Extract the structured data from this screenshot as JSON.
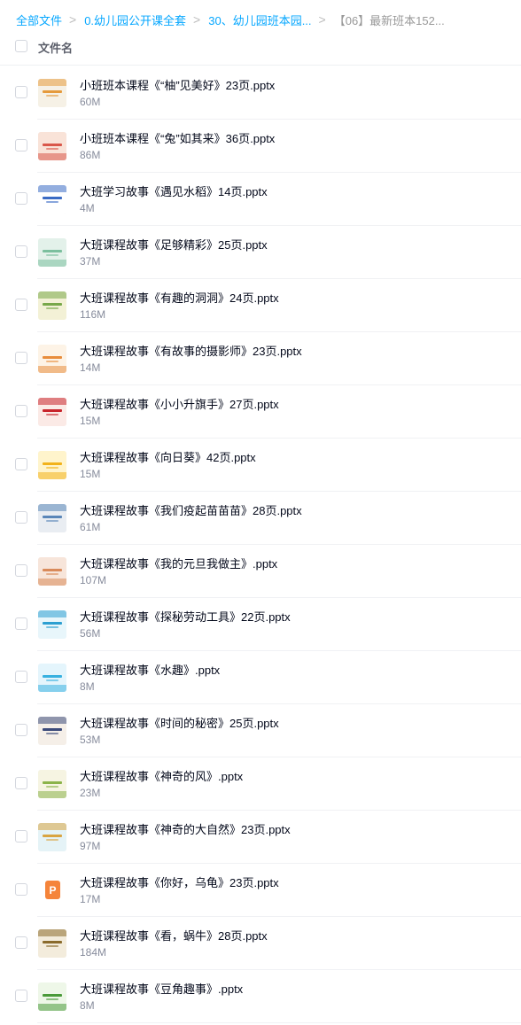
{
  "breadcrumb": {
    "items": [
      "全部文件",
      "0.幼儿园公开课全套",
      "30、幼儿园班本园...",
      "【06】最新班本152..."
    ],
    "separator": ">"
  },
  "table": {
    "column_name": "文件名"
  },
  "files": [
    {
      "name": "小班班本课程《“柚”见美好》23页.pptx",
      "size": "60M",
      "thumb_icon": "slide-thumbnail",
      "bg": "#f6f1e6",
      "accent": "#e59a3c"
    },
    {
      "name": "小班班本课程《“兔”如其来》36页.pptx",
      "size": "86M",
      "thumb_icon": "slide-thumbnail",
      "bg": "#f9e3d8",
      "accent": "#d9574a"
    },
    {
      "name": "大班学习故事《遇见水稻》14页.pptx",
      "size": "4M",
      "thumb_icon": "slide-thumbnail",
      "bg": "#ffffff",
      "accent": "#3a6bc4"
    },
    {
      "name": "大班课程故事《足够精彩》25页.pptx",
      "size": "37M",
      "thumb_icon": "slide-thumbnail",
      "bg": "#e3f1ea",
      "accent": "#7bbf9e"
    },
    {
      "name": "大班课程故事《有趣的洞洞》24页.pptx",
      "size": "116M",
      "thumb_icon": "slide-thumbnail",
      "bg": "#f3f1d6",
      "accent": "#78a84a"
    },
    {
      "name": "大班课程故事《有故事的摄影师》23页.pptx",
      "size": "14M",
      "thumb_icon": "slide-thumbnail",
      "bg": "#fdf3e6",
      "accent": "#e88d3c"
    },
    {
      "name": "大班课程故事《小小升旗手》27页.pptx",
      "size": "15M",
      "thumb_icon": "slide-thumbnail",
      "bg": "#fbeae6",
      "accent": "#c8252c"
    },
    {
      "name": "大班课程故事《向日葵》42页.pptx",
      "size": "15M",
      "thumb_icon": "slide-thumbnail",
      "bg": "#fff4cc",
      "accent": "#f2b21b"
    },
    {
      "name": "大班课程故事《我们疫起苗苗苗》28页.pptx",
      "size": "61M",
      "thumb_icon": "slide-thumbnail",
      "bg": "#e9edf2",
      "accent": "#5a86b8"
    },
    {
      "name": "大班课程故事《我的元旦我做主》.pptx",
      "size": "107M",
      "thumb_icon": "slide-thumbnail",
      "bg": "#f7e5da",
      "accent": "#d98a5a"
    },
    {
      "name": "大班课程故事《探秘劳动工具》22页.pptx",
      "size": "56M",
      "thumb_icon": "slide-thumbnail",
      "bg": "#e8f6fb",
      "accent": "#2c9fd1"
    },
    {
      "name": "大班课程故事《水趣》.pptx",
      "size": "8M",
      "thumb_icon": "slide-thumbnail",
      "bg": "#e4f5fc",
      "accent": "#38b1e0"
    },
    {
      "name": "大班课程故事《时间的秘密》25页.pptx",
      "size": "53M",
      "thumb_icon": "slide-thumbnail",
      "bg": "#f5efe8",
      "accent": "#3b4a7a"
    },
    {
      "name": "大班课程故事《神奇的风》.pptx",
      "size": "23M",
      "thumb_icon": "slide-thumbnail",
      "bg": "#f6f4e2",
      "accent": "#8bb34a"
    },
    {
      "name": "大班课程故事《神奇的大自然》23页.pptx",
      "size": "97M",
      "thumb_icon": "slide-thumbnail",
      "bg": "#e5f3f7",
      "accent": "#d9a441"
    },
    {
      "name": "大班课程故事《你好，乌龟》23页.pptx",
      "size": "17M",
      "thumb_icon": "pptx-file-icon",
      "bg": "#ffffff",
      "accent": "#f5843a"
    },
    {
      "name": "大班课程故事《看，蜗牛》28页.pptx",
      "size": "184M",
      "thumb_icon": "slide-thumbnail",
      "bg": "#f3ecdc",
      "accent": "#8a6b2c"
    },
    {
      "name": "大班课程故事《豆角趣事》.pptx",
      "size": "8M",
      "thumb_icon": "slide-thumbnail",
      "bg": "#eef7e8",
      "accent": "#4a9a3a"
    }
  ]
}
